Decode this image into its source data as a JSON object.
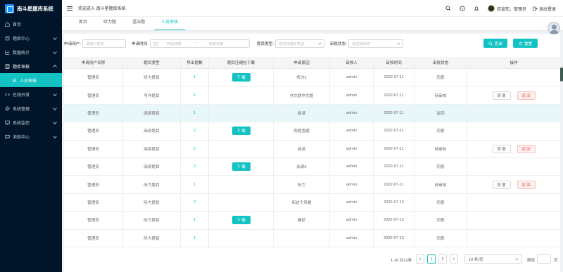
{
  "app": {
    "title": "南斗星题库系统"
  },
  "sidebar": {
    "items": [
      {
        "label": "首页",
        "icon": "home-icon",
        "has_arrow": false
      },
      {
        "label": "题库中心",
        "icon": "book-icon",
        "has_arrow": true
      },
      {
        "label": "数据统计",
        "icon": "chart-icon",
        "has_arrow": true
      },
      {
        "label": "题库审核",
        "icon": "audit-icon",
        "has_arrow": true,
        "open": true
      },
      {
        "label": "在线开发",
        "icon": "code-icon",
        "has_arrow": true
      },
      {
        "label": "系统管理",
        "icon": "gear-icon",
        "has_arrow": true
      },
      {
        "label": "系统监控",
        "icon": "monitor-icon",
        "has_arrow": true
      },
      {
        "label": "消息中心",
        "icon": "message-icon",
        "has_arrow": true
      }
    ],
    "submenu": [
      {
        "label": "人员审核",
        "icon": "user-icon",
        "active": true
      }
    ]
  },
  "header": {
    "welcome": "欢迎进入 南斗星题库系统",
    "user_text": "欢迎您，管理员",
    "logout": "退出登录"
  },
  "tabs": [
    {
      "label": "首页",
      "active": false
    },
    {
      "label": "听力题",
      "active": false
    },
    {
      "label": "语法题",
      "active": false
    },
    {
      "label": "人员审核",
      "active": true
    }
  ],
  "filters": {
    "applicant_label": "申请用户:",
    "applicant_placeholder": "请输入姓名",
    "time_label": "申请时间:",
    "start_placeholder": "开始日期",
    "range_sep": "~",
    "end_placeholder": "结束日期",
    "type_label": "题目类型:",
    "type_placeholder": "请选择题目类型",
    "status_label": "审批状态:",
    "status_placeholder": "请选择状态",
    "search_button": "查询",
    "reset_button": "重置"
  },
  "table": {
    "headers": [
      "申请用户名称",
      "题目类型",
      "导出题数",
      "题目压缩包下载",
      "申请原因",
      "审核人",
      "审核时间",
      "审批状态",
      "操作"
    ],
    "download_label": "下 载",
    "approve_label": "同 意",
    "reject_label": "驳 回",
    "rows": [
      {
        "user": "管理员",
        "type": "听力题目",
        "count": "1",
        "download": true,
        "reason": "听力2",
        "auditor": "admin",
        "time": "2022-07-11",
        "status": "同意",
        "actions": false,
        "highlight": false
      },
      {
        "user": "管理员",
        "type": "写作题目",
        "count": "1",
        "download": false,
        "reason": "作文题作文题",
        "auditor": "admin",
        "time": "2022-07-11",
        "status": "待审核",
        "actions": true,
        "highlight": false
      },
      {
        "user": "管理员",
        "type": "阅读题目",
        "count": "1",
        "download": false,
        "reason": "阅读",
        "auditor": "admin",
        "time": "2022-07-11",
        "status": "驳回",
        "actions": false,
        "highlight": true
      },
      {
        "user": "管理员",
        "type": "阅读题目",
        "count": "2",
        "download": true,
        "reason": "两题查题",
        "auditor": "admin",
        "time": "2022-07-11",
        "status": "同意",
        "actions": false,
        "highlight": false
      },
      {
        "user": "管理员",
        "type": "阅读题目",
        "count": "2",
        "download": false,
        "reason": "阅读",
        "auditor": "admin",
        "time": "2022-07-11",
        "status": "待审核",
        "actions": true,
        "highlight": false
      },
      {
        "user": "管理员",
        "type": "阅读题目",
        "count": "2",
        "download": true,
        "reason": "阅读5",
        "auditor": "admin",
        "time": "2022-07-11",
        "status": "同意",
        "actions": false,
        "highlight": false
      },
      {
        "user": "管理员",
        "type": "听力题目",
        "count": "1",
        "download": false,
        "reason": "听力",
        "auditor": "admin",
        "time": "2022-07-11",
        "status": "待审核",
        "actions": true,
        "highlight": false
      },
      {
        "user": "管理员",
        "type": "听力题目",
        "count": "2",
        "download": false,
        "reason": "和这个风格",
        "auditor": "admin",
        "time": "2022-07-12",
        "status": "同意",
        "actions": false,
        "highlight": false
      },
      {
        "user": "管理员",
        "type": "听力题目",
        "count": "1",
        "download": true,
        "reason": "辅助",
        "auditor": "admin",
        "time": "2022-07-12",
        "status": "同意",
        "actions": false,
        "highlight": false
      },
      {
        "user": "管理员",
        "type": "听力题目",
        "count": "1",
        "download": false,
        "reason": "",
        "auditor": "admin",
        "time": "2022-07-13",
        "status": "同意",
        "actions": false,
        "highlight": false
      }
    ]
  },
  "pagination": {
    "total_text": "1-10 共12条",
    "pages": [
      "1",
      "2"
    ],
    "current": "1",
    "prev": "<",
    "next": ">",
    "page_size": "10 条/页",
    "jump_label": "跳至",
    "jump_unit": "页"
  }
}
